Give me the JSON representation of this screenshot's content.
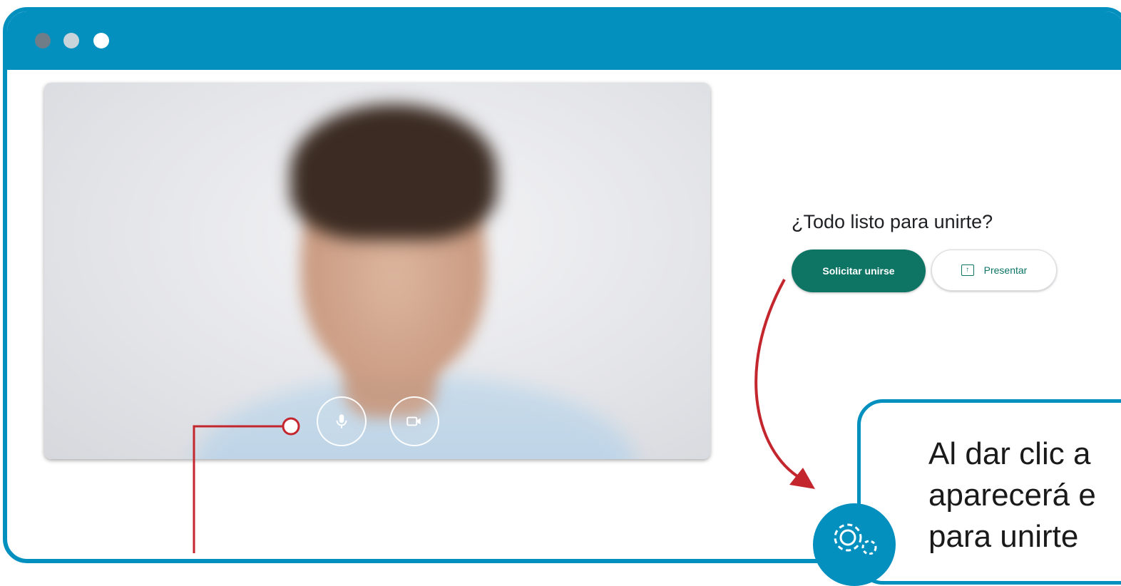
{
  "meeting": {
    "ready_title": "¿Todo listo para unirte?",
    "join_label": "Solicitar unirse",
    "present_label": "Presentar"
  },
  "callout": {
    "line1": "Al dar clic a",
    "line2": "aparecerá e",
    "line3": "para unirte"
  },
  "icons": {
    "mic": "microphone-icon",
    "camera": "video-camera-icon",
    "present": "present-screen-icon",
    "settings": "gear-icon"
  },
  "colors": {
    "frame": "#0490bf",
    "join_button": "#0e7565",
    "annotation_line": "#c4262e"
  }
}
